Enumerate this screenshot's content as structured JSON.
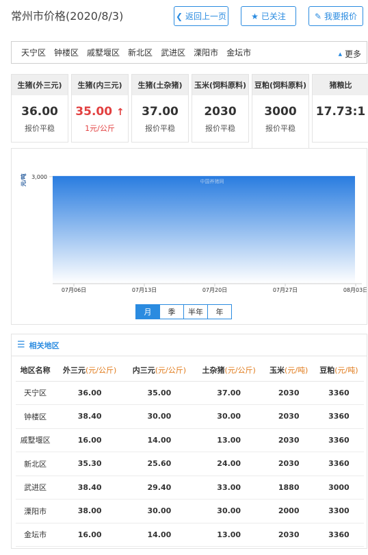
{
  "header": {
    "title": "常州市价格(2020/8/3)",
    "back_label": "返回上一页",
    "follow_label": "已关注",
    "report_label": "我要报价"
  },
  "areas": {
    "items": [
      "天宁区",
      "钟楼区",
      "戚墅堰区",
      "新北区",
      "武进区",
      "溧阳市",
      "金坛市"
    ],
    "more_label": "更多"
  },
  "cards": [
    {
      "title": "生猪(外三元)",
      "value": "36.00",
      "sub": "报价平稳",
      "trend": "flat"
    },
    {
      "title": "生猪(内三元)",
      "value": "35.00",
      "arrow": "↑",
      "sub": "1元/公斤",
      "trend": "up"
    },
    {
      "title": "生猪(土杂猪)",
      "value": "37.00",
      "sub": "报价平稳",
      "trend": "flat"
    },
    {
      "title": "玉米(饲料原料)",
      "value": "2030",
      "sub": "报价平稳",
      "trend": "flat"
    },
    {
      "title": "豆粕(饲料原料)",
      "value": "3000",
      "sub": "报价平稳",
      "trend": "flat"
    },
    {
      "title": "猪粮比",
      "value": "17.73:1",
      "sub": "",
      "trend": "flat"
    }
  ],
  "chart_data": {
    "type": "area",
    "ylabel": "元/吨",
    "yticks": [
      "3,000"
    ],
    "x_ticks": [
      "07月06日",
      "07月13日",
      "07月20日",
      "07月27日",
      "08月03日"
    ],
    "x": [
      "2020-07-04",
      "2020-08-03"
    ],
    "values": [
      3000,
      3000
    ],
    "watermark": "中国养猪网",
    "grid": false,
    "color": "#2a7de0"
  },
  "periods": {
    "items": [
      "月",
      "季",
      "半年",
      "年"
    ],
    "selected": "月"
  },
  "region": {
    "title": "相关地区",
    "columns": [
      {
        "name": "地区名称",
        "unit": ""
      },
      {
        "name": "外三元",
        "unit": "(元/公斤)"
      },
      {
        "name": "内三元",
        "unit": "(元/公斤)"
      },
      {
        "name": "土杂猪",
        "unit": "(元/公斤)"
      },
      {
        "name": "玉米",
        "unit": "(元/吨)"
      },
      {
        "name": "豆粕",
        "unit": "(元/吨)"
      }
    ],
    "rows": [
      [
        "天宁区",
        "36.00",
        "35.00",
        "37.00",
        "2030",
        "3360"
      ],
      [
        "钟楼区",
        "38.40",
        "30.00",
        "30.00",
        "2030",
        "3360"
      ],
      [
        "戚墅堰区",
        "16.00",
        "14.00",
        "13.00",
        "2030",
        "3360"
      ],
      [
        "新北区",
        "35.30",
        "25.60",
        "24.00",
        "2030",
        "3360"
      ],
      [
        "武进区",
        "38.40",
        "29.40",
        "33.00",
        "1880",
        "3000"
      ],
      [
        "溧阳市",
        "38.00",
        "30.00",
        "30.00",
        "2000",
        "3300"
      ],
      [
        "金坛市",
        "16.00",
        "14.00",
        "13.00",
        "2030",
        "3360"
      ]
    ]
  },
  "colors": {
    "accent": "#2a8be0",
    "up": "#e24040",
    "unit": "#e07a1a"
  }
}
